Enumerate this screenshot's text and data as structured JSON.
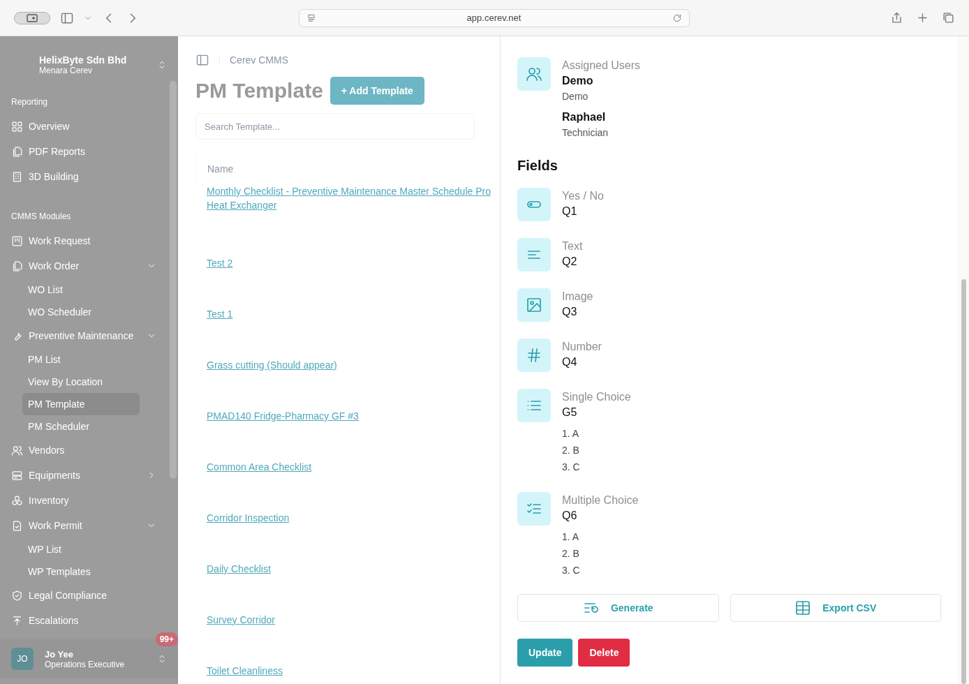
{
  "browser": {
    "url": "app.cerev.net"
  },
  "sidebar": {
    "org": {
      "name": "HelixByte Sdn Bhd",
      "site": "Menara Cerev"
    },
    "sections": [
      {
        "title": "Reporting",
        "items": [
          {
            "label": "Overview"
          },
          {
            "label": "PDF Reports"
          },
          {
            "label": "3D Building"
          }
        ]
      },
      {
        "title": "CMMS Modules",
        "items": [
          {
            "label": "Work Request"
          },
          {
            "label": "Work Order",
            "expanded": true,
            "children": [
              {
                "label": "WO List",
                "selected": false
              },
              {
                "label": "WO Scheduler",
                "selected": false
              }
            ]
          },
          {
            "label": "Preventive Maintenance",
            "expanded": true,
            "children": [
              {
                "label": "PM List",
                "selected": false
              },
              {
                "label": "View By Location",
                "selected": false
              },
              {
                "label": "PM Template",
                "selected": true
              },
              {
                "label": "PM Scheduler",
                "selected": false
              }
            ]
          },
          {
            "label": "Vendors"
          },
          {
            "label": "Equipments",
            "expanded": false
          },
          {
            "label": "Inventory"
          },
          {
            "label": "Work Permit",
            "expanded": true,
            "children": [
              {
                "label": "WP List",
                "selected": false
              },
              {
                "label": "WP Templates",
                "selected": false
              }
            ]
          },
          {
            "label": "Legal Compliance"
          },
          {
            "label": "Escalations"
          }
        ]
      }
    ],
    "user": {
      "initials": "JO",
      "name": "Jo Yee",
      "role": "Operations Executive",
      "badge": "99+"
    }
  },
  "main": {
    "breadcrumb": "Cerev CMMS",
    "title": "PM Template",
    "add_button": "+ Add Template",
    "search": {
      "placeholder": "Search Template..."
    },
    "table": {
      "columns": [
        "Name"
      ],
      "rows": [
        {
          "lines": [
            "Monthly Checklist - Preventive Maintenance Master Schedule Pro",
            "Heat Exchanger"
          ]
        },
        {
          "lines": [
            "Test 2"
          ]
        },
        {
          "lines": [
            "Test 1"
          ]
        },
        {
          "lines": [
            "Grass cutting (Should appear)"
          ]
        },
        {
          "lines": [
            "PMAD140 Fridge-Pharmacy GF #3"
          ]
        },
        {
          "lines": [
            "Common Area Checklist"
          ]
        },
        {
          "lines": [
            "Corridor Inspection"
          ]
        },
        {
          "lines": [
            "Daily Checklist"
          ]
        },
        {
          "lines": [
            "Survey Corridor"
          ]
        },
        {
          "lines": [
            "Toilet Cleanliness"
          ]
        }
      ]
    }
  },
  "drawer": {
    "assigned": {
      "label": "Assigned Users",
      "users": [
        {
          "name": "Demo",
          "role": "Demo"
        },
        {
          "name": "Raphael",
          "role": "Technician"
        }
      ]
    },
    "fields_title": "Fields",
    "fields": [
      {
        "kind": "yes_no",
        "type_label": "Yes / No",
        "name": "Q1"
      },
      {
        "kind": "text",
        "type_label": "Text",
        "name": "Q2"
      },
      {
        "kind": "image",
        "type_label": "Image",
        "name": "Q3"
      },
      {
        "kind": "number",
        "type_label": "Number",
        "name": "Q4"
      },
      {
        "kind": "single_choice",
        "type_label": "Single Choice",
        "name": "G5",
        "options": [
          "1. A",
          "2. B",
          "3. C"
        ]
      },
      {
        "kind": "multiple_choice",
        "type_label": "Multiple Choice",
        "name": "Q6",
        "options": [
          "1. A",
          "2. B",
          "3. C"
        ]
      }
    ],
    "actions": [
      {
        "kind": "generate",
        "label": "Generate"
      },
      {
        "kind": "export",
        "label": "Export CSV"
      }
    ],
    "buttons": [
      {
        "kind": "primary",
        "label": "Update"
      },
      {
        "kind": "danger",
        "label": "Delete"
      }
    ]
  }
}
